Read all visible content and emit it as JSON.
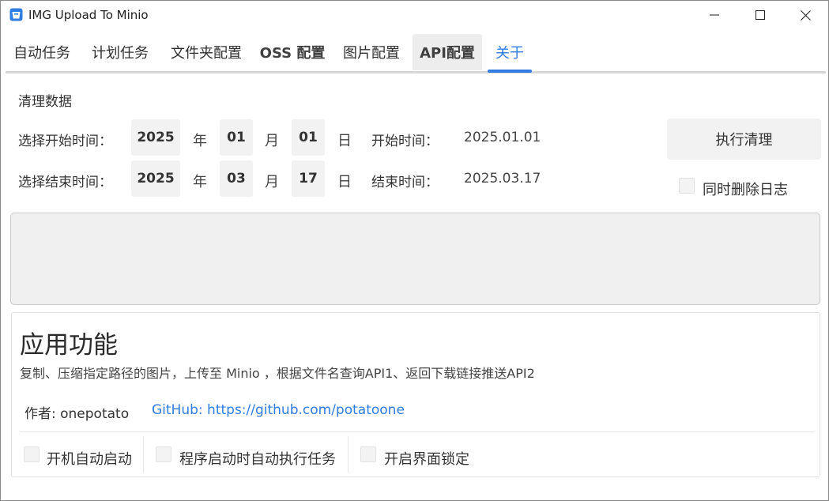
{
  "window": {
    "title": "IMG Upload To Minio",
    "icon": "bucket-app-icon"
  },
  "tabs": [
    {
      "label": "自动任务"
    },
    {
      "label": "计划任务"
    },
    {
      "label": "文件夹配置"
    },
    {
      "label": "OSS 配置"
    },
    {
      "label": "图片配置"
    },
    {
      "label": "API配置"
    },
    {
      "label": "关于"
    }
  ],
  "active_tab": "关于",
  "accent_color": "#2f7de1",
  "clean": {
    "section_title": "清理数据",
    "start": {
      "label": "选择开始时间：",
      "year": "2025",
      "month": "01",
      "day": "01",
      "summary_label": "开始时间：",
      "summary_value": "2025.01.01"
    },
    "end": {
      "label": "选择结束时间：",
      "year": "2025",
      "month": "03",
      "day": "17",
      "summary_label": "结束时间：",
      "summary_value": "2025.03.17"
    },
    "units": {
      "year": "年",
      "month": "月",
      "day": "日"
    },
    "execute_button": "执行清理",
    "delete_logs_label": "同时删除日志",
    "delete_logs_checked": false
  },
  "about": {
    "title": "应用功能",
    "description": "复制、压缩指定路径的图片，上传至 Minio ，根据文件名查询API1、返回下载链接推送API2",
    "author": "作者: onepotato",
    "github": "GitHub: https://github.com/potatoone"
  },
  "options": [
    {
      "label": "开机自动启动",
      "checked": false
    },
    {
      "label": "程序启动时自动执行任务",
      "checked": false
    },
    {
      "label": "开启界面锁定",
      "checked": false
    }
  ]
}
